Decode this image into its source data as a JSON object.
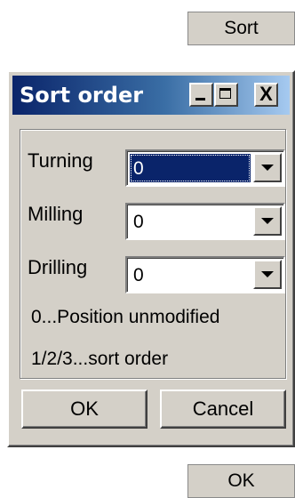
{
  "external": {
    "sort_label": "Sort",
    "ok_label": "OK"
  },
  "dialog": {
    "title": "Sort order",
    "fields": [
      {
        "label": "Turning",
        "value": "0"
      },
      {
        "label": "Milling",
        "value": "0"
      },
      {
        "label": "Drilling",
        "value": "0"
      }
    ],
    "info_lines": [
      "0...Position unmodified",
      "1/2/3...sort order"
    ],
    "ok_label": "OK",
    "cancel_label": "Cancel",
    "close_glyph": "X"
  },
  "colors": {
    "title_start": "#0a246a",
    "title_end": "#a6caf0",
    "face": "#d4d0c8",
    "selection": "#0a246a"
  },
  "icons": [
    "minimize-icon",
    "maximize-icon",
    "close-icon",
    "dropdown-arrow-icon"
  ]
}
